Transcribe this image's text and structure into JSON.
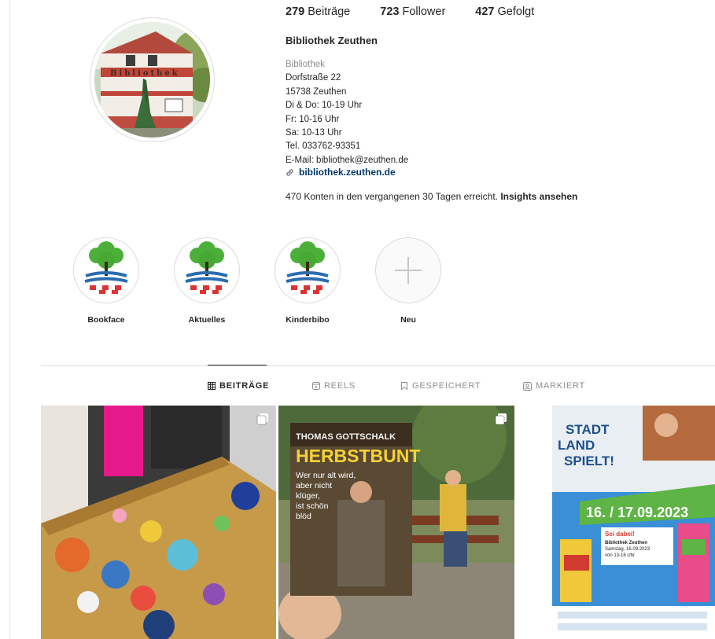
{
  "stats": {
    "posts_count": "279",
    "posts_label": "Beiträge",
    "followers_count": "723",
    "followers_label": "Follower",
    "following_count": "427",
    "following_label": "Gefolgt"
  },
  "profile": {
    "name": "Bibliothek Zeuthen",
    "category": "Bibliothek",
    "bio_lines": [
      "Dorfstraße 22",
      "15738 Zeuthen",
      "Di & Do: 10-19 Uhr",
      "Fr: 10-16 Uhr",
      "Sa: 10-13 Uhr",
      "Tel. 033762-93351",
      "E-Mail: bibliothek@zeuthen.de"
    ],
    "website": "bibliothek.zeuthen.de",
    "avatar_sign_text": "Bibliothek",
    "insights_text": "470 Konten in den vergangenen 30 Tagen erreicht.",
    "insights_link": "Insights ansehen"
  },
  "highlights": [
    {
      "label": "Bookface"
    },
    {
      "label": "Aktuelles"
    },
    {
      "label": "Kinderbibo"
    },
    {
      "label": "Neu"
    }
  ],
  "tabs": [
    {
      "label": "BEITRÄGE",
      "icon": "grid-icon",
      "active": true
    },
    {
      "label": "REELS",
      "icon": "reels-icon",
      "active": false
    },
    {
      "label": "GESPEICHERT",
      "icon": "bookmark-icon",
      "active": false
    },
    {
      "label": "MARKIERT",
      "icon": "tagged-icon",
      "active": false
    }
  ],
  "posts": [
    {
      "description": "suitcase with stickers",
      "multi": true
    },
    {
      "multi": true,
      "book_author": "THOMAS GOTTSCHALK",
      "book_title": "HERBSTBUNT",
      "book_subtitle": [
        "Wer nur alt wird,",
        "aber nicht",
        "klüger,",
        "ist schön",
        "blöd"
      ]
    },
    {
      "multi": false,
      "poster_title_1": "STADT",
      "poster_title_2": "LAND",
      "poster_title_3": "SPIELT!",
      "poster_date": "16. / 17.09.2023",
      "poster_heading": "Sei dabei!",
      "poster_lines": [
        "Bibliothek Zeuthen",
        "Samstag, 16.09.2023",
        "von 13-16 Uhr"
      ]
    }
  ],
  "colors": {
    "link": "#00376b",
    "muted": "#8e8e8e",
    "border": "#dbdbdb",
    "poster_blue": "#3a8fd6",
    "poster_green": "#5fb446"
  }
}
